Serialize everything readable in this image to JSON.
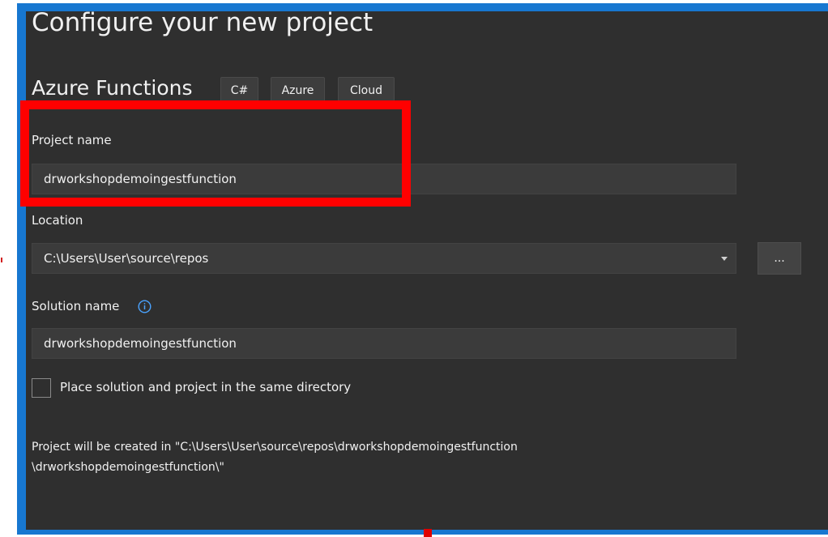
{
  "header": {
    "title": "Configure your new project",
    "template_name": "Azure Functions",
    "tags": [
      "C#",
      "Azure",
      "Cloud"
    ]
  },
  "project_name": {
    "label": "Project name",
    "value": "drworkshopdemoingestfunction"
  },
  "location": {
    "label": "Location",
    "value": "C:\\Users\\User\\source\\repos",
    "browse_label": "..."
  },
  "solution_name": {
    "label": "Solution name",
    "value": "drworkshopdemoingestfunction"
  },
  "same_directory": {
    "label": "Place solution and project in the same directory",
    "checked": false
  },
  "summary": {
    "line1": "Project will be created in \"C:\\Users\\User\\source\\repos\\drworkshopdemoingestfunction",
    "line2": "\\drworkshopdemoingestfunction\\\""
  },
  "colors": {
    "background": "#2f2f2f",
    "frame_border": "#1777d0",
    "highlight": "#ff0000",
    "text": "#f1f1f1",
    "field": "#3b3b3b",
    "info_icon": "#4aa3ff"
  },
  "icons": [
    "info-icon",
    "chevron-down-icon"
  ]
}
